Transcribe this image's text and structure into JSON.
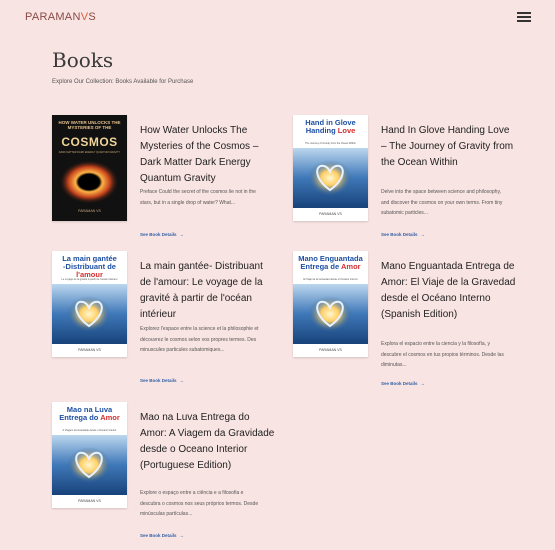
{
  "header": {
    "logo_main": "PARAMAN",
    "logo_accent": "V",
    "logo_end": "S"
  },
  "page": {
    "title": "Books",
    "subtitle": "Explore Our Collection: Books Available for Purchase"
  },
  "colors": {
    "background": "#f8e4e2",
    "link": "#2f5fa8",
    "title_text": "#222222"
  },
  "books": [
    {
      "title": "How Water Unlocks The Mysteries of the Cosmos – Dark Matter Dark Energy Quantum Gravity",
      "description": "Preface Could the secret of the cosmos lie not in the stars, but in a single drop of water? What...",
      "link": "See Book Details",
      "cover_small": "HOW WATER UNLOCKS THE MYSTERIES OF THE",
      "cover_big": "COSMOS",
      "cover_sub": "DARK MATTER DARK ENERGY QUANTUM GRAVITY",
      "cover_author": "PARAMAN VS"
    },
    {
      "title": "Hand In Glove Handing Love – The Journey of Gravity from the Ocean Within",
      "description": "Delve into the space between science and philosophy, and discover the cosmos on your own terms. From tiny subatomic particles...",
      "link": "See Book Details",
      "cover_title_a": "Hand in Glove",
      "cover_title_b": "Handing ",
      "cover_title_red": "Love",
      "cover_sub": "The Journey of Gravity from the Ocean Within",
      "cover_author": "PARAMAN VS"
    },
    {
      "title": "La main gantée- Distribuant de l'amour: Le voyage de la gravité à partir de l'océan intérieur",
      "description": "Explorez l'espace entre la science et la philosophie et découvrez le cosmos selon vos propres termes. Des minuscules particules subatomiques...",
      "link": "See Book Details",
      "cover_title_a": "La main gantée",
      "cover_title_b": "-Distribuant de ",
      "cover_title_red": "l'amour",
      "cover_sub": "Le voyage de la gravité à partir de l'océan intérieur",
      "cover_author": "PARAMAN VS"
    },
    {
      "title": "Mano Enguantada Entrega de Amor: El Viaje de la Gravedad desde el Océano Interno (Spanish Edition)",
      "description": "Explora el espacio entre la ciencia y la filosofía, y descubre el cosmos en tus propios términos. Desde las diminutas...",
      "link": "See Book Details",
      "cover_title_a": "Mano Enguantada",
      "cover_title_b": "Entrega de ",
      "cover_title_red": "Amor",
      "cover_sub": "El Viaje de la Gravedad desde el Océano Interno",
      "cover_author": "PARAMAN VS"
    },
    {
      "title": "Mao na Luva Entrega do Amor: A Viagem da Gravidade desde o Oceano Interior (Portuguese Edition)",
      "description": "Explore o espaço entre a ciência e a filosofia e descubra o cosmos nos seus próprios termos. Desde minúsculas partículas...",
      "link": "See Book Details",
      "cover_title_a": "Mao na Luva",
      "cover_title_b": "Entrega do ",
      "cover_title_red": "Amor",
      "cover_sub": "A Viagem da Gravidade desde o Oceano Interior",
      "cover_author": "PARAMAN VS"
    }
  ]
}
